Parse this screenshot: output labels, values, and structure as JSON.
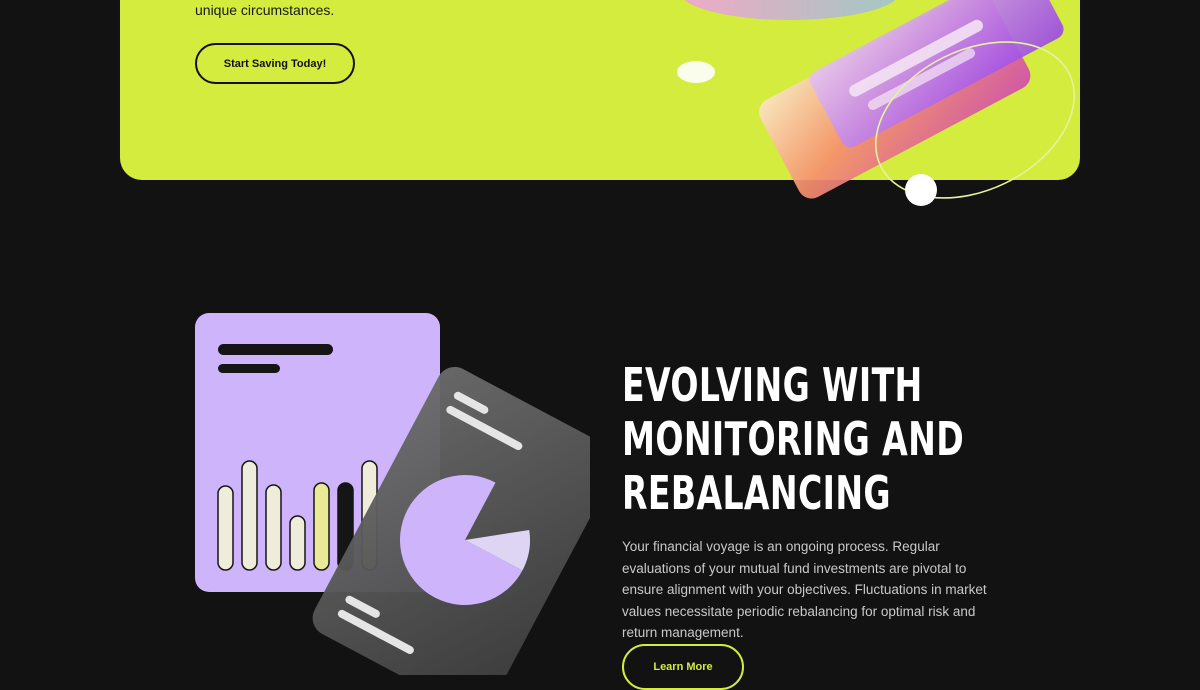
{
  "hero": {
    "text": "unique circumstances.",
    "cta_label": "Start Saving Today!"
  },
  "feature": {
    "title": "EVOLVING WITH\nMONITORING AND\nREBALANCING",
    "body": "Your financial voyage is an ongoing process. Regular evaluations of your mutual fund investments are pivotal to ensure alignment with your objectives. Fluctuations in market values necessitate periodic rebalancing for optimal risk and return management.",
    "cta_label": "Learn More"
  },
  "colors": {
    "background": "#121212",
    "accent_lime": "#d4ec3e",
    "card_purple": "#cdb4fb",
    "bar_cream": "#efedd9",
    "bar_yellow": "#eaea96"
  },
  "illustration": {
    "bar_chart_levels": [
      0.66,
      0.85,
      0.66,
      0.4,
      0.68,
      0.68,
      0.85
    ],
    "pie_fill_fraction": 0.75
  }
}
